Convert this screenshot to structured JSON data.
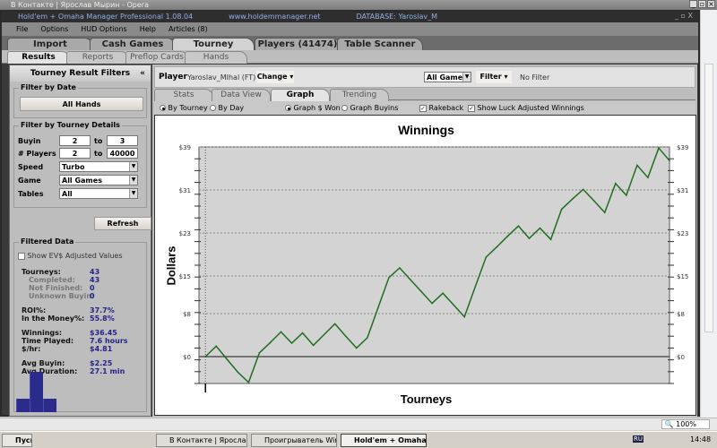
{
  "browser": {
    "title": "В Контакте | Ярослав Мырин - Opera",
    "zoom": "100%"
  },
  "app": {
    "title": "Hold'em + Omaha Manager Professional 1.08.04",
    "site": "www.holdemmanager.net",
    "database": "DATABASE: Yaroslav_M"
  },
  "menu": [
    "File",
    "Options",
    "HUD Options",
    "Help",
    "Articles (8)"
  ],
  "main_tabs": [
    {
      "label": "Import"
    },
    {
      "label": "Cash Games"
    },
    {
      "label": "Tourney",
      "active": true
    },
    {
      "label": "Players (41474)"
    },
    {
      "label": "Table Scanner"
    }
  ],
  "sub_tabs": [
    {
      "label": "Results",
      "active": true
    },
    {
      "label": "Reports"
    },
    {
      "label": "Preflop Cards"
    },
    {
      "label": "Hands"
    }
  ],
  "filters": {
    "title": "Tourney Result Filters",
    "collapse": "«",
    "date_title": "Filter by Date",
    "all_hands": "All Hands",
    "details_title": "Filter by Tourney Details",
    "buyin_label": "Buyin",
    "buyin_from": "2",
    "buyin_to": "3",
    "to": "to",
    "players_label": "# Players",
    "players_from": "2",
    "players_to": "40000",
    "speed_label": "Speed",
    "speed": "Turbo",
    "game_label": "Game",
    "game": "All Games",
    "tables_label": "Tables",
    "tables": "All",
    "refresh": "Refresh"
  },
  "filtered": {
    "title": "Filtered Data",
    "ev_label": "Show EV$ Adjusted Values",
    "ev_checked": false,
    "stats": [
      {
        "label": "Tourneys:",
        "value": "43"
      },
      {
        "label": "Completed:",
        "value": "43",
        "sub": true
      },
      {
        "label": "Not Finished:",
        "value": "0",
        "sub": true
      },
      {
        "label": "Unknown Buyin:",
        "value": "0",
        "sub": true
      },
      {
        "label": "ROI%:",
        "value": "37.7%"
      },
      {
        "label": "In the Money%:",
        "value": "55.8%"
      },
      {
        "label": "Winnings:",
        "value": "$36.45"
      },
      {
        "label": "Time Played:",
        "value": "7.6 hours"
      },
      {
        "label": "$/hr:",
        "value": "$4.81"
      },
      {
        "label": "Avg Buyin:",
        "value": "$2.25"
      },
      {
        "label": "Avg Duration:",
        "value": "27.1 min"
      }
    ],
    "histogram": [
      1,
      3,
      1
    ],
    "histogram_color": "#2b2b8c"
  },
  "player": {
    "label": "Player",
    "name": "Yaroslav_MIhal (FT)",
    "change": "Change",
    "games": "All Games",
    "filter": "Filter",
    "filter_state": "No Filter"
  },
  "graph_tabs": [
    {
      "label": "Stats"
    },
    {
      "label": "Data View"
    },
    {
      "label": "Graph",
      "active": true
    },
    {
      "label": "Trending"
    }
  ],
  "options": {
    "by_tourney": "By Tourney",
    "by_day": "By Day",
    "graph_won": "Graph $ Won",
    "graph_buyins": "Graph Buyins",
    "rakeback": "Rakeback",
    "luck": "Show Luck Adjusted Winnings"
  },
  "chart_data": {
    "type": "line",
    "title": "Winnings",
    "xlabel": "Tourneys",
    "ylabel": "Dollars",
    "x": [
      0,
      1,
      2,
      3,
      4,
      5,
      6,
      7,
      8,
      9,
      10,
      11,
      12,
      13,
      14,
      15,
      16,
      17,
      18,
      19,
      20,
      21,
      22,
      23,
      24,
      25,
      26,
      27,
      28,
      29,
      30,
      31,
      32,
      33,
      34,
      35,
      36,
      37,
      38,
      39,
      40,
      41,
      42,
      43
    ],
    "values": [
      0,
      1.95,
      -0.5,
      -2.9,
      -4.8,
      0.7,
      2.6,
      4.6,
      2.5,
      4.4,
      2.1,
      4.1,
      6.1,
      3.8,
      1.6,
      3.5,
      9.1,
      14.7,
      16.5,
      14.3,
      12.1,
      9.9,
      11.8,
      9.6,
      7.4,
      13,
      18.5,
      20.4,
      22.4,
      24.3,
      22,
      23.9,
      21.8,
      27.4,
      29.3,
      31.1,
      29,
      26.8,
      32.2,
      30,
      35.6,
      33.3,
      38.8,
      36.45
    ],
    "ylim": [
      -5,
      39
    ],
    "yticks": [
      0,
      8,
      15,
      23,
      31,
      39
    ],
    "ytick_labels": [
      "$0",
      "$8",
      "$15",
      "$23",
      "$31",
      "$39"
    ],
    "grid": true,
    "line_color": "#1e6e1e",
    "plot_bg": "#d3d3d3"
  },
  "taskbar": {
    "start": "Пуск",
    "tasks": [
      {
        "label": "В Контакте | Ярослав ..."
      },
      {
        "label": "Проигрыватель Windo..."
      },
      {
        "label": "Hold'em + Omaha Ma...",
        "active": true
      }
    ],
    "lang": "RU",
    "time": "14:48"
  }
}
